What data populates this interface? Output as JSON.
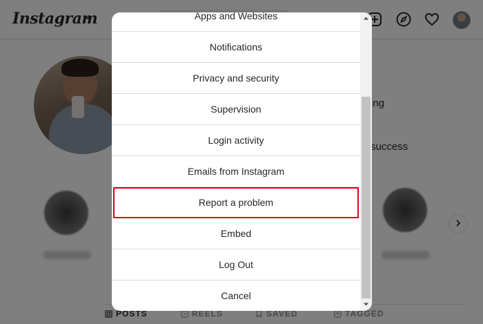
{
  "header": {
    "logo_text": "Instagram",
    "icons": [
      "chevron-down-icon",
      "new-post-icon",
      "explore-icon",
      "heart-icon",
      "avatar"
    ]
  },
  "profile": {
    "partial_text_1": "ing",
    "partial_text_2": "success"
  },
  "tabs": [
    {
      "label": "POSTS",
      "icon": "grid-icon",
      "active": true
    },
    {
      "label": "REELS",
      "icon": "reels-icon",
      "active": false
    },
    {
      "label": "SAVED",
      "icon": "bookmark-icon",
      "active": false
    },
    {
      "label": "TAGGED",
      "icon": "tag-icon",
      "active": false
    }
  ],
  "modal": {
    "items": [
      {
        "label": "Apps and Websites"
      },
      {
        "label": "Notifications"
      },
      {
        "label": "Privacy and security"
      },
      {
        "label": "Supervision"
      },
      {
        "label": "Login activity"
      },
      {
        "label": "Emails from Instagram"
      },
      {
        "label": "Report a problem",
        "highlighted": true
      },
      {
        "label": "Embed"
      },
      {
        "label": "Log Out"
      },
      {
        "label": "Cancel"
      }
    ],
    "highlight_color": "#e0001b"
  }
}
